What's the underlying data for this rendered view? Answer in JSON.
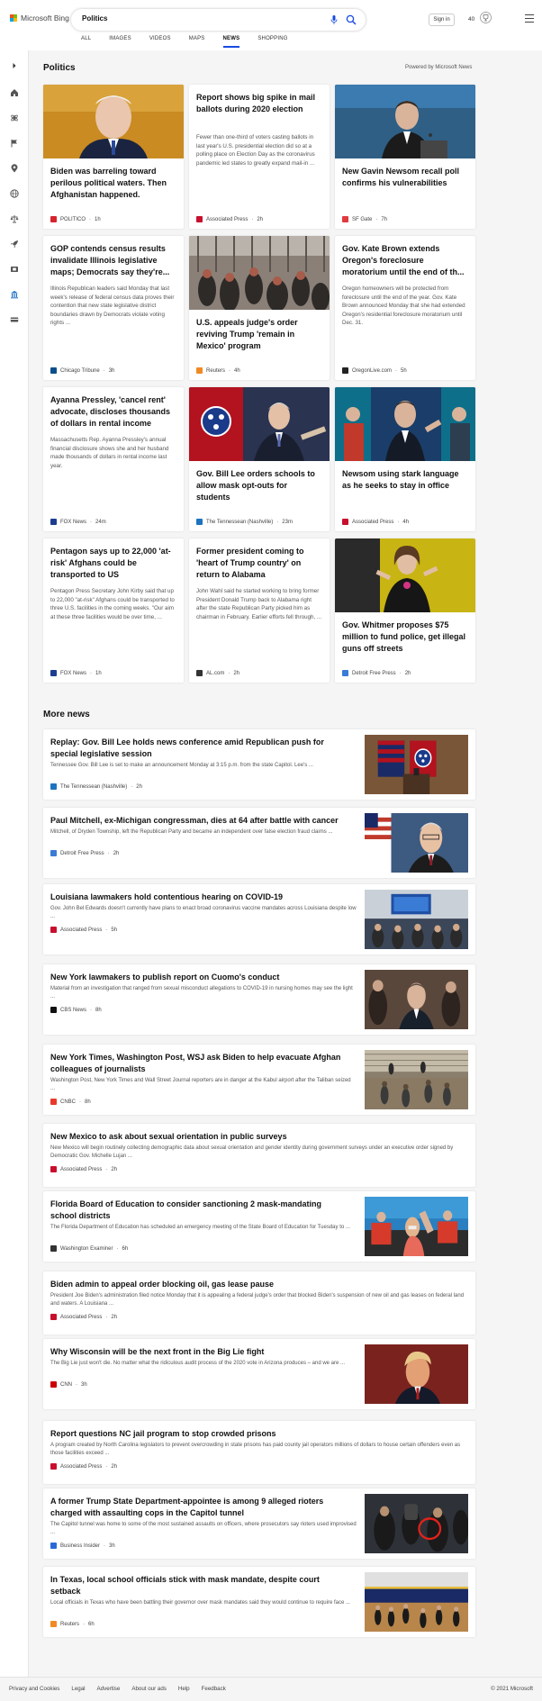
{
  "header": {
    "logo_text": "Microsoft Bing",
    "search_value": "Politics",
    "signin_label": "Sign in",
    "points": "40",
    "logo_colors": [
      "#f25022",
      "#7fba00",
      "#00a4ef",
      "#ffb900"
    ],
    "accent": "#174ae4"
  },
  "tabs": [
    {
      "label": "ALL",
      "active": false
    },
    {
      "label": "IMAGES",
      "active": false
    },
    {
      "label": "VIDEOS",
      "active": false
    },
    {
      "label": "MAPS",
      "active": false
    },
    {
      "label": "NEWS",
      "active": true
    },
    {
      "label": "SHOPPING",
      "active": false
    }
  ],
  "rail_icons": [
    "chevron-right-icon",
    "home-icon",
    "science-icon",
    "flag-icon",
    "location-pin-icon",
    "globe-icon",
    "balance-icon",
    "rocket-icon",
    "film-icon",
    "bank-icon",
    "money-icon"
  ],
  "section": {
    "title": "Politics",
    "powered": "Powered by Microsoft News"
  },
  "cards": [
    {
      "title": "Biden was barreling toward perilous political waters. Then Afghanistan happened.",
      "snippet": "",
      "source": "POLITICO",
      "age": "1h",
      "source_color": "#d6242c",
      "image": "biden-portrait"
    },
    {
      "title": "Report shows big spike in mail ballots during 2020 election",
      "snippet": "Fewer than one-third of voters casting ballots in last year's U.S. presidential election did so at a polling place on Election Day as the coronavirus pandemic led states to greatly expand mail-in ...",
      "source": "Associated Press",
      "age": "2h",
      "source_color": "#c8102e",
      "image": ""
    },
    {
      "title": "New Gavin Newsom recall poll confirms his vulnerabilities",
      "snippet": "",
      "source": "SF Gate",
      "age": "7h",
      "source_color": "#e03a3e",
      "image": "newsom-podium"
    },
    {
      "title": "GOP contends census results invalidate Illinois legislative maps; Democrats say they're...",
      "snippet": "Illinois Republican leaders said Monday that last week's release of federal census data proves their contention that new state legislative district boundaries drawn by Democrats violate voting rights ...",
      "source": "Chicago Tribune",
      "age": "3h",
      "source_color": "#0b4f8a",
      "image": ""
    },
    {
      "title": "U.S. appeals judge's order reviving Trump 'remain in Mexico' program",
      "snippet": "",
      "source": "Reuters",
      "age": "4h",
      "source_color": "#f08a24",
      "image": "border-crowd"
    },
    {
      "title": "Gov. Kate Brown extends Oregon's foreclosure moratorium until the end of th...",
      "snippet": "Oregon homeowners will be protected from foreclosure until the end of the year. Gov. Kate Brown announced Monday that she had extended Oregon's residential foreclosure moratorium until Dec. 31.",
      "source": "OregonLive.com",
      "age": "5h",
      "source_color": "#222222",
      "image": ""
    },
    {
      "title": "Ayanna Pressley, 'cancel rent' advocate, discloses thousands of dollars in rental income",
      "snippet": "Massachusetts Rep. Ayanna Pressley's annual financial disclosure shows she and her husband made thousands of dollars in rental income last year.",
      "source": "FOX News",
      "age": "24m",
      "source_color": "#1d3d8f",
      "image": ""
    },
    {
      "title": "Gov. Bill Lee orders schools to allow mask opt-outs for students",
      "snippet": "",
      "source": "The Tennessean (Nashville)",
      "age": "23m",
      "source_color": "#1e73be",
      "image": "lee-flags"
    },
    {
      "title": "Newsom using stark language as he seeks to stay in office",
      "snippet": "",
      "source": "Associated Press",
      "age": "4h",
      "source_color": "#c8102e",
      "image": "newsom-rally"
    },
    {
      "title": "Pentagon says up to 22,000 'at-risk' Afghans could be transported to US",
      "snippet": "Pentagon Press Secretary John Kirby said that up to 22,000 \"at-risk\" Afghans could be transported to three U.S. facilities in the coming weeks. \"Our aim at these three facilities would be over time, ...",
      "source": "FOX News",
      "age": "1h",
      "source_color": "#1d3d8f",
      "image": ""
    },
    {
      "title": "Former president coming to 'heart of Trump country' on return to Alabama",
      "snippet": "John Wahl said he started working to bring former President Donald Trump back to Alabama right after the state Republican Party picked him as chairman in February. Earlier efforts fell through, ...",
      "source": "AL.com",
      "age": "2h",
      "source_color": "#333333",
      "image": ""
    },
    {
      "title": "Gov. Whitmer proposes $75 million to fund police, get illegal guns off streets",
      "snippet": "",
      "source": "Detroit Free Press",
      "age": "2h",
      "source_color": "#3a7bd5",
      "image": "whitmer"
    }
  ],
  "more_news": {
    "title": "More news",
    "items": [
      {
        "title": "Replay: Gov. Bill Lee holds news conference amid Republican push for special legislative session",
        "snippet": "Tennessee Gov. Bill Lee is set to make an announcement Monday at 3:15 p.m. from the state Capitol. Lee's ...",
        "source": "The Tennessean (Nashville)",
        "age": "2h",
        "source_color": "#1e73be",
        "image": "tn-podium"
      },
      {
        "title": "Paul Mitchell, ex-Michigan congressman, dies at 64 after battle with cancer",
        "snippet": "Mitchell, of Dryden Township, left the Republican Party and became an independent over false election fraud claims ...",
        "source": "Detroit Free Press",
        "age": "2h",
        "source_color": "#3a7bd5",
        "image": "mitchell"
      },
      {
        "title": "Louisiana lawmakers hold contentious hearing on COVID-19",
        "snippet": "Gov. John Bel Edwards doesn't currently have plans to enact broad coronavirus vaccine mandates across Louisiana despite low ...",
        "source": "Associated Press",
        "age": "5h",
        "source_color": "#c8102e",
        "image": "hearing-room"
      },
      {
        "title": "New York lawmakers to publish report on Cuomo's conduct",
        "snippet": "Material from an investigation that ranged from sexual misconduct allegations to COVID-19 in nursing homes may see the light ...",
        "source": "CBS News",
        "age": "8h",
        "source_color": "#111111",
        "image": "cuomo"
      },
      {
        "title": "New York Times, Washington Post, WSJ ask Biden to help evacuate Afghan colleagues of journalists",
        "snippet": "Washington Post, New York Times and Wall Street Journal reporters are in danger at the Kabul airport after the Taliban seized ...",
        "source": "CNBC",
        "age": "8h",
        "source_color": "#e8392b",
        "image": "kabul-wall"
      },
      {
        "title": "New Mexico to ask about sexual orientation in public surveys",
        "snippet": "New Mexico will begin routinely collecting demographic data about sexual orientation and gender identity during government surveys under an executive order signed by Democratic Gov. Michelle Lujan ...",
        "source": "Associated Press",
        "age": "2h",
        "source_color": "#c8102e",
        "image": ""
      },
      {
        "title": "Florida Board of Education to consider sanctioning 2 mask-mandating school districts",
        "snippet": "The Florida Department of Education has scheduled an emergency meeting of the State Board of Education for Tuesday to ...",
        "source": "Washington Examiner",
        "age": "6h",
        "source_color": "#333333",
        "image": "classroom"
      },
      {
        "title": "Biden admin to appeal order blocking oil, gas lease pause",
        "snippet": "President Joe Biden's administration filed notice Monday that it is appealing a federal judge's order that blocked Biden's suspension of new oil and gas leases on federal land and waters. A Louisiana ...",
        "source": "Associated Press",
        "age": "2h",
        "source_color": "#c8102e",
        "image": ""
      },
      {
        "title": "Why Wisconsin will be the next front in the Big Lie fight",
        "snippet": "The Big Lie just won't die. No matter what the ridiculous audit process of the 2020 vote in Arizona produces – and we are ...",
        "source": "CNN",
        "age": "3h",
        "source_color": "#cc0000",
        "image": "trump"
      },
      {
        "title": "Report questions NC jail program to stop crowded prisons",
        "snippet": "A program created by North Carolina legislators to prevent overcrowding in state prisons has paid county jail operators millions of dollars to house certain offenders even as those facilities exceed ...",
        "source": "Associated Press",
        "age": "2h",
        "source_color": "#c8102e",
        "image": ""
      },
      {
        "title": "A former Trump State Department-appointee is among 9 alleged rioters charged with assaulting cops in the Capitol tunnel",
        "snippet": "The Capitol tunnel was home to some of the most sustained assaults on officers, where prosecutors say rioters used improvised ...",
        "source": "Business Insider",
        "age": "3h",
        "source_color": "#2a6ad8",
        "image": "riot"
      },
      {
        "title": "In Texas, local school officials stick with mask mandate, despite court setback",
        "snippet": "Local officials in Texas who have been battling their governor over mask mandates said they would continue to require face ...",
        "source": "Reuters",
        "age": "6h",
        "source_color": "#f08a24",
        "image": "gym"
      }
    ]
  },
  "footer": {
    "links": [
      "Privacy and Cookies",
      "Legal",
      "Advertise",
      "About our ads",
      "Help",
      "Feedback"
    ],
    "copyright": "© 2021 Microsoft"
  }
}
